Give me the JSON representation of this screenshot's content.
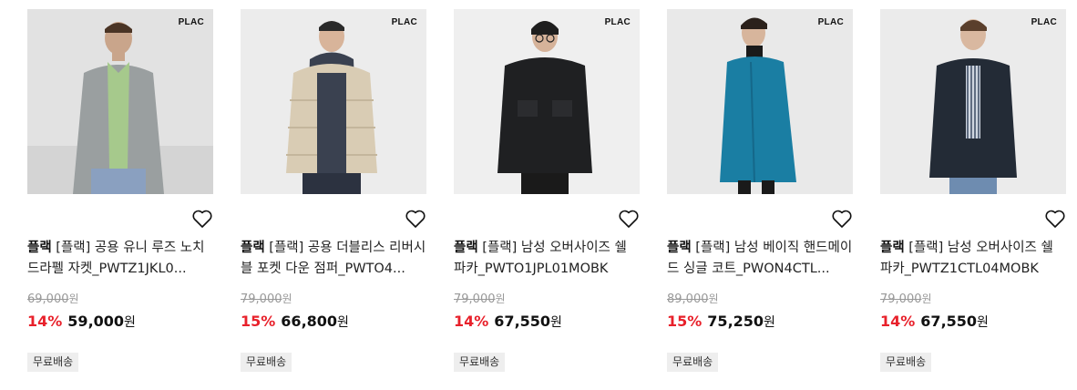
{
  "products": [
    {
      "logo": "PLAC",
      "brand": "플랙",
      "title": "[플랙] 공용 유니 루즈 노치드라펠 자켓_PWTZ1JKL0...",
      "original_price": "69,000",
      "original_unit": "원",
      "discount": "14%",
      "sale_price": "59,000",
      "sale_unit": "원",
      "shipping": "무료배송"
    },
    {
      "logo": "PLAC",
      "brand": "플랙",
      "title": "[플랙] 공용 더블리스 리버시블 포켓 다운 점퍼_PWTO4...",
      "original_price": "79,000",
      "original_unit": "원",
      "discount": "15%",
      "sale_price": "66,800",
      "sale_unit": "원",
      "shipping": "무료배송"
    },
    {
      "logo": "PLAC",
      "brand": "플랙",
      "title": "[플랙] 남성 오버사이즈 쉘 파카_PWTO1JPL01MOBK",
      "original_price": "79,000",
      "original_unit": "원",
      "discount": "14%",
      "sale_price": "67,550",
      "sale_unit": "원",
      "shipping": "무료배송"
    },
    {
      "logo": "PLAC",
      "brand": "플랙",
      "title": "[플랙] 남성 베이직 핸드메이드 싱글 코트_PWON4CTL...",
      "original_price": "89,000",
      "original_unit": "원",
      "discount": "15%",
      "sale_price": "75,250",
      "sale_unit": "원",
      "shipping": "무료배송"
    },
    {
      "logo": "PLAC",
      "brand": "플랙",
      "title": "[플랙] 남성 오버사이즈 쉘 파카_PWTZ1CTL04MOBK",
      "original_price": "79,000",
      "original_unit": "원",
      "discount": "14%",
      "sale_price": "67,550",
      "sale_unit": "원",
      "shipping": "무료배송"
    }
  ],
  "colors": {
    "discount": "#e8212b",
    "original_price": "#999999",
    "badge_bg": "#eeeeee"
  },
  "icons": {
    "wishlist": "heart-outline-icon"
  }
}
